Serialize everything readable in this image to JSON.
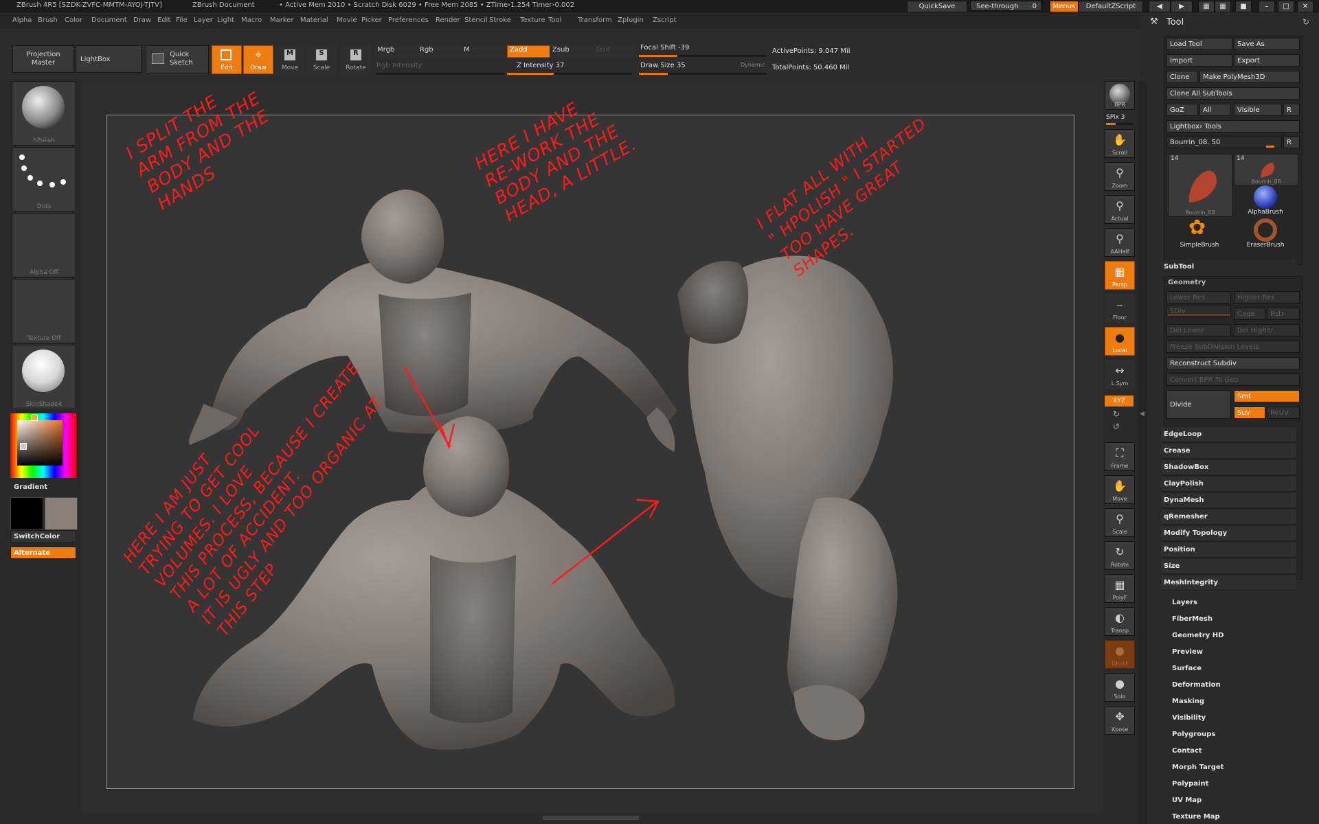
{
  "titlebar": {
    "app": "ZBrush 4R5 [SZDK-ZVFC-MMTM-AYOJ-TJTV]",
    "document": "ZBrush Document",
    "stats": "• Active Mem 2010  • Scratch Disk 6029  • Free Mem 2085  • ZTime›1.254 Timer›0.002",
    "quicksave": "QuickSave",
    "seethrough": "See-through",
    "seethrough_value": "0",
    "menus": "Menus",
    "zscript": "DefaultZScript"
  },
  "menubar": [
    "Alpha",
    "Brush",
    "Color",
    "Document",
    "Draw",
    "Edit",
    "File",
    "Layer",
    "Light",
    "Macro",
    "Marker",
    "Material",
    "Movie",
    "Picker",
    "Preferences",
    "Render",
    "Stencil",
    "Stroke",
    "Texture",
    "Tool",
    "Transform",
    "Zplugin",
    "Zscript"
  ],
  "shelf": {
    "projection_master": "Projection\nMaster",
    "lightbox": "LightBox",
    "quick_sketch": "Quick\nSketch",
    "edit": "Edit",
    "draw": "Draw",
    "move": "Move",
    "scale": "Scale",
    "rotate": "Rotate",
    "mrgb": "Mrgb",
    "rgb": "Rgb",
    "m": "M",
    "rgb_intensity": "Rgb Intensity",
    "zadd": "Zadd",
    "zsub": "Zsub",
    "zcut": "Zcut",
    "z_intensity": "Z Intensity 37",
    "focal_shift": "Focal Shift -39",
    "draw_size": "Draw Size 35",
    "dynamic": "Dynamic",
    "active_points": "ActivePoints: 9.047 Mil",
    "total_points": "TotalPoints: 50.460 Mil"
  },
  "left_tray": {
    "brush": "hPolish",
    "stroke": "Dots",
    "alpha": "Alpha Off",
    "texture": "Texture Off",
    "material": "SkinShade4",
    "gradient": "Gradient",
    "switchcolor": "SwitchColor",
    "alternate": "Alternate"
  },
  "notes": {
    "top_left": "I SPLIT THE\nARM FROM THE\nBODY AND THE\nHANDS",
    "top_center": "HERE I HAVE\nRE-WORK THE\nBODY AND THE\nHEAD, A LITTLE.",
    "top_right": "I FLAT ALL WITH\n\" HPOLISH \" I STARTED\nTOO HAVE GREAT\nSHAPES.",
    "bottom_left": "HERE I AM JUST\nTRYING TO GET COOL\nVOLUMES. I LOVE\nTHIS PROCESS, BECAUSE I CREATE\nA LOT OF ACCIDENT.\nIT IS UGLY AND TOO ORGANIC AT\nTHIS STEP"
  },
  "right_strip": [
    {
      "name": "bpr",
      "label": "BPR",
      "active": false
    },
    {
      "name": "scroll",
      "label": "Scroll",
      "active": false
    },
    {
      "name": "zoom",
      "label": "Zoom",
      "active": false
    },
    {
      "name": "actual",
      "label": "Actual",
      "active": false
    },
    {
      "name": "aahalf",
      "label": "AAHalf",
      "active": false
    },
    {
      "name": "persp",
      "label": "Persp",
      "active": true
    },
    {
      "name": "floor",
      "label": "Floor",
      "active": false
    },
    {
      "name": "local",
      "label": "Local",
      "active": true
    },
    {
      "name": "lsym",
      "label": "L.Sym",
      "active": false
    },
    {
      "name": "frame",
      "label": "Frame",
      "active": false
    },
    {
      "name": "move",
      "label": "Move",
      "active": false
    },
    {
      "name": "scale",
      "label": "Scale",
      "active": false
    },
    {
      "name": "rotate",
      "label": "Rotate",
      "active": false
    },
    {
      "name": "polyf",
      "label": "PolyF",
      "active": false
    },
    {
      "name": "transp",
      "label": "Transp",
      "active": false
    },
    {
      "name": "ghost",
      "label": "Ghost",
      "active": false
    },
    {
      "name": "solo",
      "label": "Solo",
      "active": false
    },
    {
      "name": "xpose",
      "label": "Xpose",
      "active": false
    }
  ],
  "spix": "SPix 3",
  "xyz": "XYZ",
  "tool": {
    "title": "Tool",
    "load_tool": "Load Tool",
    "save_as": "Save As",
    "import": "Import",
    "export": "Export",
    "clone": "Clone",
    "make_polymesh": "Make PolyMesh3D",
    "clone_all": "Clone All SubTools",
    "goz": "GoZ",
    "all": "All",
    "visible": "Visible",
    "r": "R",
    "lightbox_tools": "Lightbox› Tools",
    "current": "Bourrin_08. 50",
    "thumbs": [
      {
        "label": "Bourrin_08",
        "count": "14"
      },
      {
        "label": "Bourrin_08",
        "count": "14"
      },
      {
        "label": "AlphaBrush",
        "count": ""
      },
      {
        "label": "SimpleBrush",
        "count": ""
      },
      {
        "label": "EraserBrush",
        "count": ""
      }
    ],
    "subtool": "SubTool",
    "geometry": "Geometry",
    "lower_res": "Lower Res",
    "higher_res": "Higher Res",
    "sdiv": "SDiv",
    "cage": "Cage",
    "rstr": "Rstr",
    "del_lower": "Del Lower",
    "del_higher": "Del Higher",
    "freeze": "Freeze SubDivision Levels",
    "reconstruct": "Reconstruct Subdiv",
    "convert_bpr": "Convert BPR To Geo",
    "divide": "Divide",
    "smt": "Smt",
    "suv": "Suv",
    "reuv": "ReUV",
    "geo_items": [
      "EdgeLoop",
      "Crease",
      "ShadowBox",
      "ClayPolish",
      "DynaMesh",
      "qRemesher",
      "Modify Topology",
      "Position",
      "Size",
      "MeshIntegrity"
    ],
    "sections": [
      "Layers",
      "FiberMesh",
      "Geometry HD",
      "Preview",
      "Surface",
      "Deformation",
      "Masking",
      "Visibility",
      "Polygroups",
      "Contact",
      "Morph Target",
      "Polypaint",
      "UV Map",
      "Texture Map"
    ]
  },
  "colors": {
    "accent": "#ef7c10",
    "annotation": "#ff1a1a",
    "clay": "#8d8580"
  }
}
